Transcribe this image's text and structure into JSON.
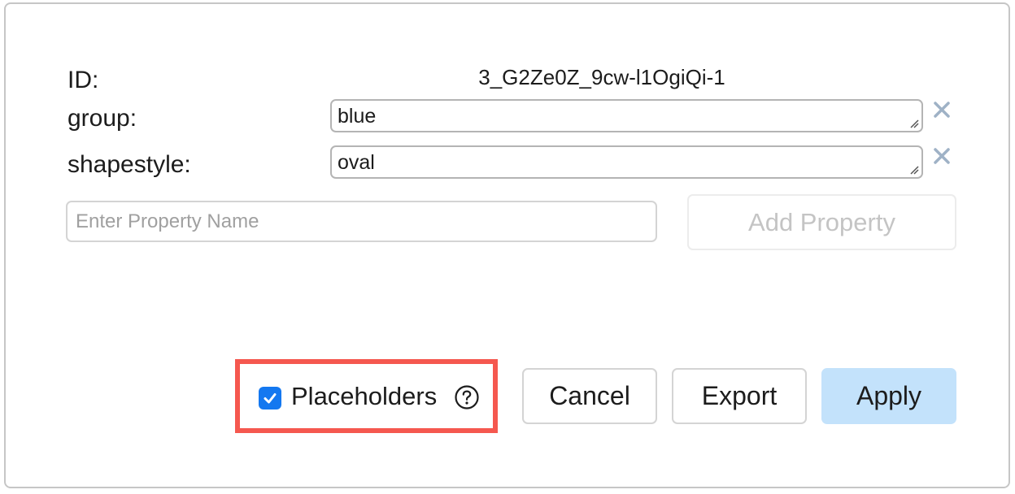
{
  "dialog": {
    "id_label": "ID:",
    "id_value": "3_G2Ze0Z_9cw-l1OgiQi-1",
    "properties": [
      {
        "name": "group:",
        "value": "blue"
      },
      {
        "name": "shapestyle:",
        "value": "oval"
      }
    ],
    "new_property": {
      "placeholder": "Enter Property Name",
      "value": "",
      "add_button_label": "Add Property"
    },
    "placeholders": {
      "label": "Placeholders",
      "checked": true
    },
    "buttons": {
      "cancel": "Cancel",
      "export": "Export",
      "apply": "Apply"
    }
  },
  "icons": {
    "remove": "close-icon",
    "help": "question-circle-icon",
    "checkbox": "checkmark-icon"
  },
  "colors": {
    "accent": "#1478f0",
    "apply_button_bg": "#c3e2fb",
    "highlight": "#f5584f",
    "remove_icon": "#9fb2c6"
  }
}
